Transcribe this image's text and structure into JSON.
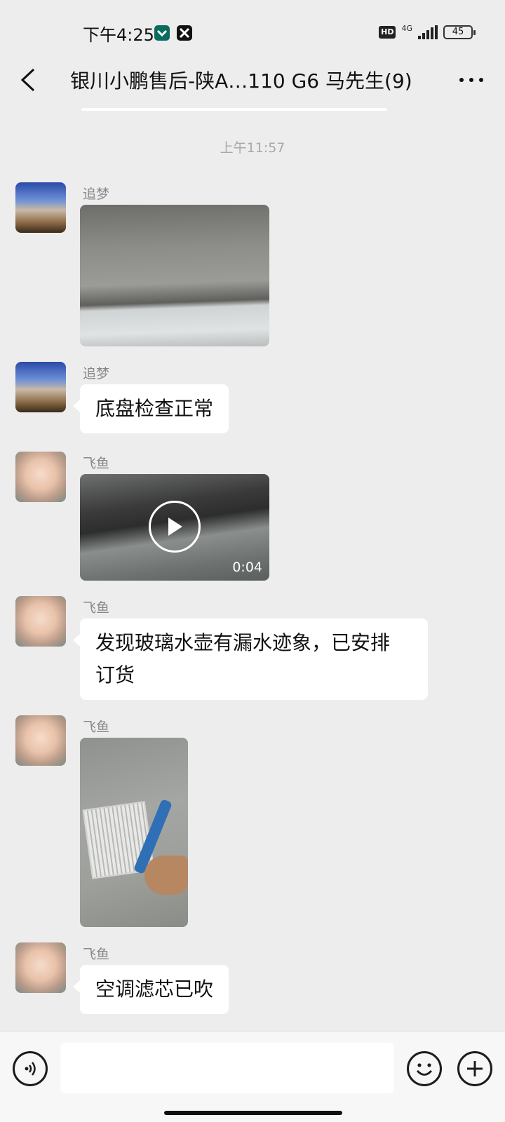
{
  "status_bar": {
    "time": "下午4:25",
    "network": "4G",
    "hd": "HD",
    "battery": "45"
  },
  "header": {
    "title": "银川小鹏售后-陕A…110 G6 马先生(9)"
  },
  "time_divider": "上午11:57",
  "messages": [
    {
      "sender": "追梦",
      "type": "image",
      "image": "car-chassis-photo"
    },
    {
      "sender": "追梦",
      "type": "text",
      "text": "底盘检查正常"
    },
    {
      "sender": "飞鱼",
      "type": "video",
      "duration": "0:04"
    },
    {
      "sender": "飞鱼",
      "type": "text",
      "text_line1": "发现玻璃水壶有漏水迹象，已安排",
      "text_line2": "订货"
    },
    {
      "sender": "飞鱼",
      "type": "image",
      "image": "air-filter-photo"
    },
    {
      "sender": "飞鱼",
      "type": "text",
      "text": "空调滤芯已吹"
    }
  ],
  "input_bar": {
    "placeholder": "",
    "icons": [
      "voice-icon",
      "emoji-icon",
      "plus-icon"
    ]
  }
}
